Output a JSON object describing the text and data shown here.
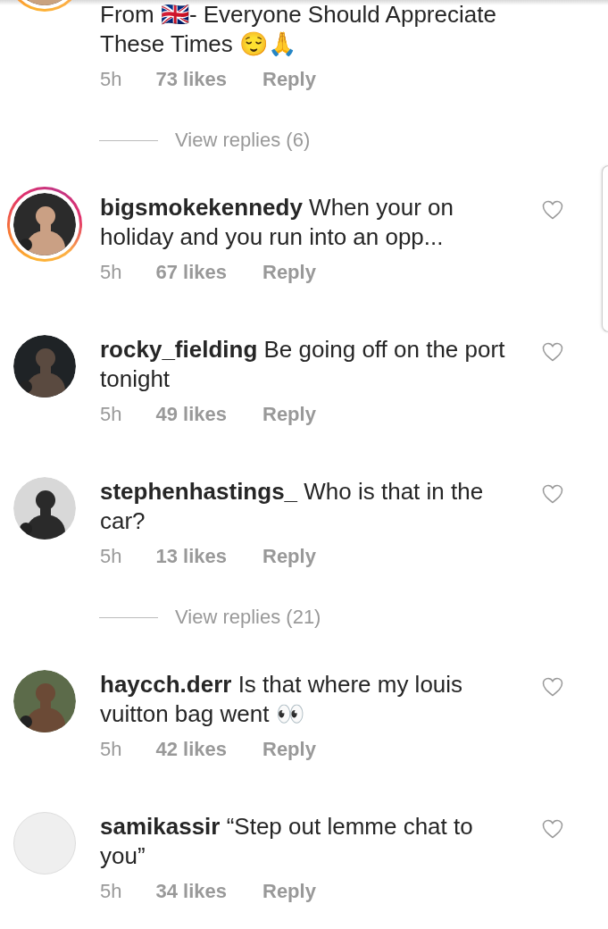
{
  "comments": [
    {
      "text": "From 🇬🇧- Everyone Should Appreciate These Times 😌🙏",
      "time": "5h",
      "likes": "73 likes",
      "reply": "Reply",
      "avatar": {
        "kind": "picture",
        "story_ring": true
      },
      "view_replies": "View replies (6)"
    },
    {
      "username": "bigsmokekennedy",
      "text": "When your on holiday and you run into an opp...",
      "time": "5h",
      "likes": "67 likes",
      "reply": "Reply",
      "avatar": {
        "kind": "picture",
        "story_ring": true
      },
      "liked": false
    },
    {
      "username": "rocky_fielding",
      "text": "Be going off on the port tonight",
      "time": "5h",
      "likes": "49 likes",
      "reply": "Reply",
      "avatar": {
        "kind": "picture",
        "story_ring": false
      },
      "liked": false
    },
    {
      "username": "stephenhastings_",
      "text": "Who is that in the car?",
      "time": "5h",
      "likes": "13 likes",
      "reply": "Reply",
      "avatar": {
        "kind": "picture",
        "story_ring": false
      },
      "liked": false,
      "view_replies": "View replies (21)"
    },
    {
      "username": "haycch.derr",
      "text": "Is that where my louis vuitton bag went 👀",
      "time": "5h",
      "likes": "42 likes",
      "reply": "Reply",
      "avatar": {
        "kind": "picture",
        "story_ring": false
      },
      "liked": false
    },
    {
      "username": "samikassir",
      "text": "“Step out lemme chat to you”",
      "time": "5h",
      "likes": "34 likes",
      "reply": "Reply",
      "avatar": {
        "kind": "empty",
        "story_ring": false
      },
      "liked": false
    }
  ]
}
